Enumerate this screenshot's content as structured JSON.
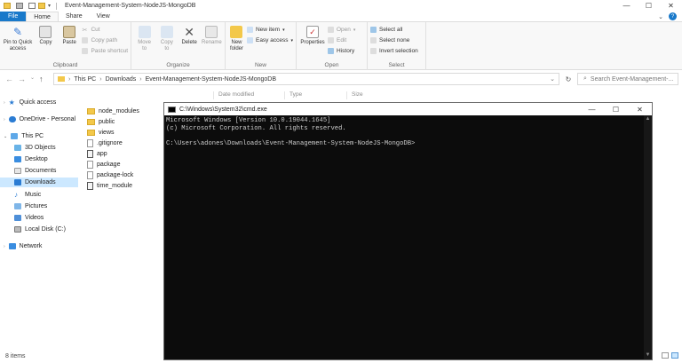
{
  "window": {
    "title": "Event-Management-System-NodeJS-MongoDB",
    "controls": [
      "—",
      "☐",
      "✕"
    ]
  },
  "tabs": [
    "File",
    "Home",
    "Share",
    "View"
  ],
  "ribbon": {
    "clipboard": {
      "label": "Clipboard",
      "pin_line1": "Pin to Quick",
      "pin_line2": "access",
      "copy": "Copy",
      "paste": "Paste",
      "cut": "Cut",
      "copy_path": "Copy path",
      "paste_shortcut": "Paste shortcut"
    },
    "organize": {
      "label": "Organize",
      "move_to": "Move",
      "move_to2": "to",
      "copy_to": "Copy",
      "copy_to2": "to",
      "delete": "Delete",
      "rename": "Rename"
    },
    "new": {
      "label": "New",
      "new_folder1": "New",
      "new_folder2": "folder",
      "new_item": "New item",
      "easy_access": "Easy access"
    },
    "open": {
      "label": "Open",
      "properties": "Properties",
      "open": "Open",
      "edit": "Edit",
      "history": "History"
    },
    "select": {
      "label": "Select",
      "select_all": "Select all",
      "select_none": "Select none",
      "invert": "Invert selection"
    }
  },
  "address": {
    "crumbs": [
      "This PC",
      "Downloads",
      "Event-Management-System-NodeJS-MongoDB"
    ],
    "search_placeholder": "Search Event-Management-..."
  },
  "nav": {
    "quick_access": "Quick access",
    "onedrive": "OneDrive - Personal",
    "this_pc": "This PC",
    "objects3d": "3D Objects",
    "desktop": "Desktop",
    "documents": "Documents",
    "downloads": "Downloads",
    "music": "Music",
    "pictures": "Pictures",
    "videos": "Videos",
    "local_disk": "Local Disk (C:)",
    "network": "Network"
  },
  "columns": {
    "date_modified": "Date modified",
    "type": "Type",
    "size": "Size"
  },
  "files": [
    {
      "name": "node_modules",
      "kind": "folder"
    },
    {
      "name": "public",
      "kind": "folder"
    },
    {
      "name": "views",
      "kind": "folder"
    },
    {
      "name": ".gitignore",
      "kind": "doc"
    },
    {
      "name": "app",
      "kind": "js"
    },
    {
      "name": "package",
      "kind": "doc"
    },
    {
      "name": "package-lock",
      "kind": "doc"
    },
    {
      "name": "time_module",
      "kind": "js"
    }
  ],
  "status": {
    "item_count": "8 items"
  },
  "cmd": {
    "title": "C:\\Windows\\System32\\cmd.exe",
    "line1": "Microsoft Windows [Version 10.0.19044.1645]",
    "line2": "(c) Microsoft Corporation. All rights reserved.",
    "line3": "",
    "line4": "C:\\Users\\adones\\Downloads\\Event-Management-System-NodeJS-MongoDB>"
  },
  "colors": {
    "file_tab": "#1979ca",
    "selected_nav": "#cce8ff",
    "console_bg": "#0c0c0c",
    "console_text": "#cccccc"
  }
}
